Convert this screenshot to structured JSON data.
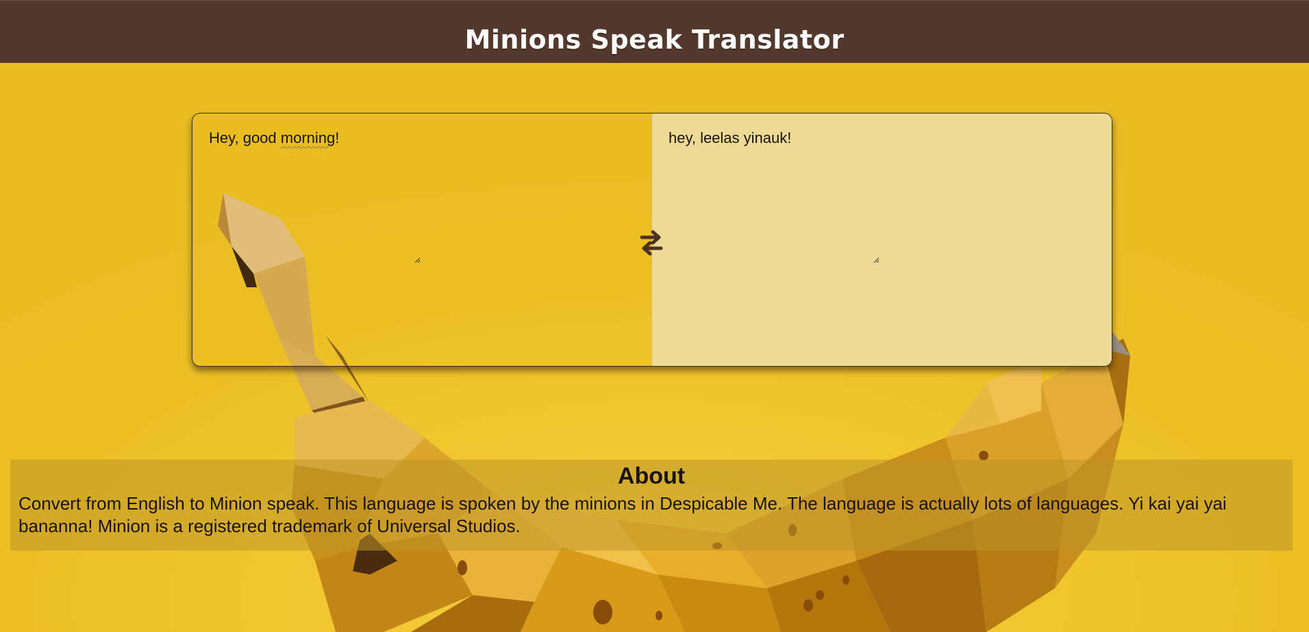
{
  "header": {
    "title": "Minions Speak Translator"
  },
  "translator": {
    "input": {
      "text_before": "Hey, good ",
      "text_misspelled": "morning",
      "text_after": "!"
    },
    "output": {
      "value": "hey, leelas yinauk!"
    },
    "swap_icon": "swap-arrows-icon"
  },
  "about": {
    "heading": "About",
    "body": "Convert from English to Minion speak. This language is spoken by the minions in Despicable Me. The language is actually lots of languages. Yi kai yai yai bananna! Minion is a registered trademark of Universal Studios."
  },
  "colors": {
    "header_bg": "#53382d",
    "page_bg": "#ecc025",
    "output_bg": "#ecd896",
    "text": "#1a1208"
  }
}
